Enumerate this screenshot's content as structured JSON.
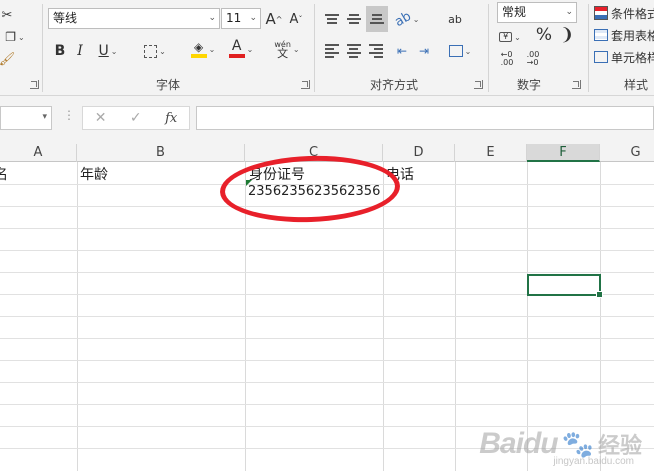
{
  "ribbon": {
    "font_group_label": "字体",
    "align_group_label": "对齐方式",
    "number_group_label": "数字",
    "styles_group_label": "样式",
    "font_name": "等线",
    "font_size": "11",
    "bold": "B",
    "italic": "I",
    "underline": "U",
    "font_color_letter": "A",
    "phonetic_top": "wén",
    "phonetic_bottom": "文",
    "number_format": "常规",
    "percent": "%",
    "comma": "❩",
    "cond_format_label": "条件格式",
    "table_format_label": "套用表格",
    "cell_style_label": "单元格样",
    "fill_color": "#ffd600",
    "font_color": "#e02020"
  },
  "formula_bar": {
    "fx": "fx",
    "cancel": "✕",
    "confirm": "✓",
    "value": ""
  },
  "sheet": {
    "columns": [
      "A",
      "B",
      "C",
      "D",
      "E",
      "F",
      "G"
    ],
    "selected_column": "F",
    "row1": {
      "a": "名",
      "b": "年龄",
      "c": "身份证号",
      "d": "电话"
    },
    "row2": {
      "c": "2356235623562356"
    },
    "accent_color": "#217346",
    "annotation_color": "#e8202a"
  },
  "watermark": {
    "brand": "Baidu",
    "suffix": "经验",
    "url": "jingyan.baidu.com"
  }
}
